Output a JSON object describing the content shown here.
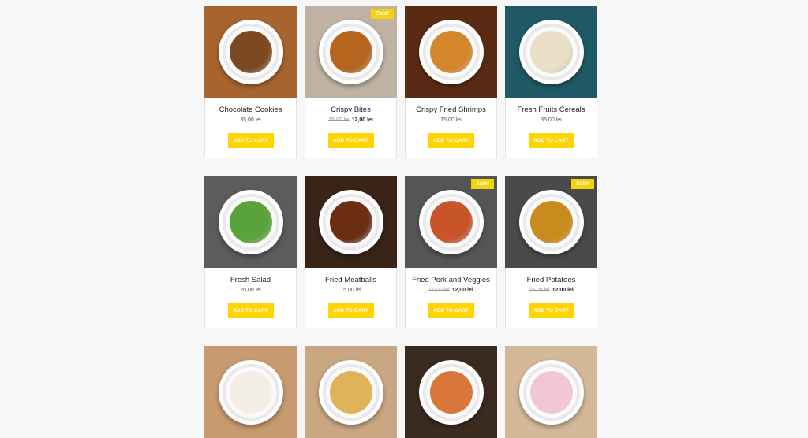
{
  "colors": {
    "accent": "#ffd400",
    "background": "#f7f7f8"
  },
  "products": [
    {
      "name": "Chocolate Cookies",
      "price": "35,00 lei",
      "old_price": "",
      "sale": "",
      "button": "ADD TO CART",
      "food_icon": "cookies-image",
      "bg": "#a8642f",
      "food": "#7b4a22"
    },
    {
      "name": "Crispy Bites",
      "price": "12,00 lei",
      "old_price": "15,00 lei",
      "sale": "Sale!",
      "button": "ADD TO CART",
      "food_icon": "crispy-bites-image",
      "bg": "#bfb2a3",
      "food": "#b5651d"
    },
    {
      "name": "Crispy Fried Shrimps",
      "price": "15,00 lei",
      "old_price": "",
      "sale": "",
      "button": "ADD TO CART",
      "food_icon": "shrimps-image",
      "bg": "#5a2b14",
      "food": "#d4862c"
    },
    {
      "name": "Fresh Fruits Cereals",
      "price": "35,00 lei",
      "old_price": "",
      "sale": "",
      "button": "ADD TO CART",
      "food_icon": "cereals-image",
      "bg": "#1f5a66",
      "food": "#e9dfc7"
    },
    {
      "name": "Fresh Salad",
      "price": "20,00 lei",
      "old_price": "",
      "sale": "",
      "button": "ADD TO CART",
      "food_icon": "salad-image",
      "bg": "#5c5c5c",
      "food": "#5aa33a"
    },
    {
      "name": "Fried Meatballs",
      "price": "15,00 lei",
      "old_price": "",
      "sale": "",
      "button": "ADD TO CART",
      "food_icon": "meatballs-image",
      "bg": "#3a2418",
      "food": "#6b2e15"
    },
    {
      "name": "Fried Pork and Veggies",
      "price": "12,00 lei",
      "old_price": "15,00 lei",
      "sale": "Sale!",
      "button": "ADD TO CART",
      "food_icon": "pork-veggies-image",
      "bg": "#555555",
      "food": "#c8552a"
    },
    {
      "name": "Fried Potatoes",
      "price": "12,00 lei",
      "old_price": "15,00 lei",
      "sale": "Sale!",
      "button": "ADD TO CART",
      "food_icon": "potatoes-image",
      "bg": "#4a4a4a",
      "food": "#c98a1e"
    }
  ],
  "more_products": [
    {
      "food_icon": "fruit-dessert-image",
      "bg": "#c79a70",
      "food": "#f3eee6"
    },
    {
      "food_icon": "waffle-image",
      "bg": "#c9a782",
      "food": "#e0b25a"
    },
    {
      "food_icon": "pizza-image",
      "bg": "#3b2a20",
      "food": "#d9763a"
    },
    {
      "food_icon": "cake-image",
      "bg": "#d3b89a",
      "food": "#f1c7d6"
    }
  ]
}
